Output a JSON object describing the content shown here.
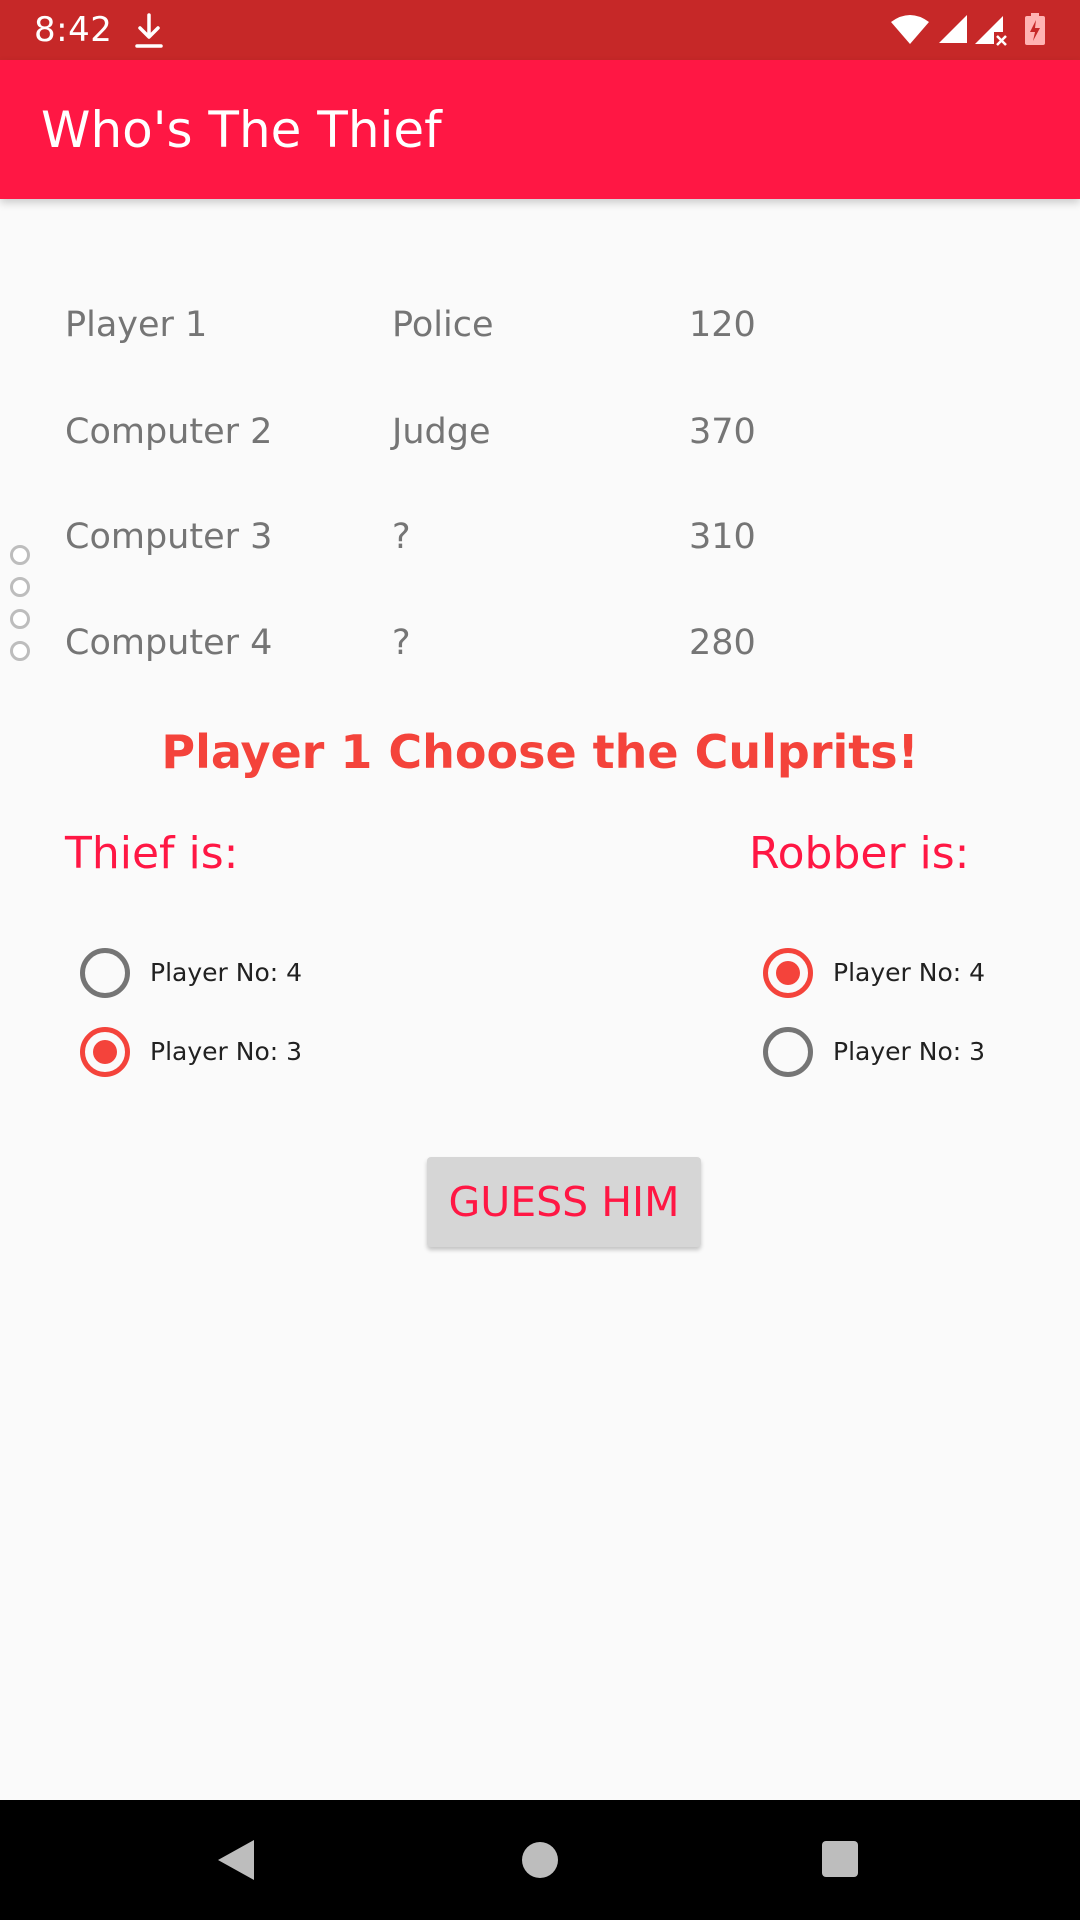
{
  "status_bar": {
    "time": "8:42",
    "icons": [
      "download-icon",
      "wifi-icon",
      "signal-icon",
      "signal-x-icon",
      "battery-charging-icon"
    ]
  },
  "app_bar": {
    "title": "Who's The Thief"
  },
  "scoreboard": {
    "rows": [
      {
        "name": "Player 1",
        "role": "Police",
        "score": "120"
      },
      {
        "name": "Computer 2",
        "role": "Judge",
        "score": "370"
      },
      {
        "name": "Computer 3",
        "role": "?",
        "score": "310"
      },
      {
        "name": "Computer 4",
        "role": "?",
        "score": "280"
      }
    ]
  },
  "prompt": "Player 1 Choose the Culprits!",
  "thief": {
    "label": "Thief is:",
    "options": [
      {
        "label": "Player No: 4",
        "checked": false
      },
      {
        "label": "Player No: 3",
        "checked": true
      }
    ]
  },
  "robber": {
    "label": "Robber is:",
    "options": [
      {
        "label": "Player No: 4",
        "checked": true
      },
      {
        "label": "Player No: 3",
        "checked": false
      }
    ]
  },
  "guess_button": {
    "label": "GUESS HIM"
  },
  "colors": {
    "status_bar": "#c62828",
    "app_bar": "#ff1744",
    "accent": "#f4433b",
    "button_bg": "#d6d6d6"
  },
  "nav_bar": {
    "icons": [
      "back-icon",
      "home-icon",
      "recents-icon"
    ]
  }
}
